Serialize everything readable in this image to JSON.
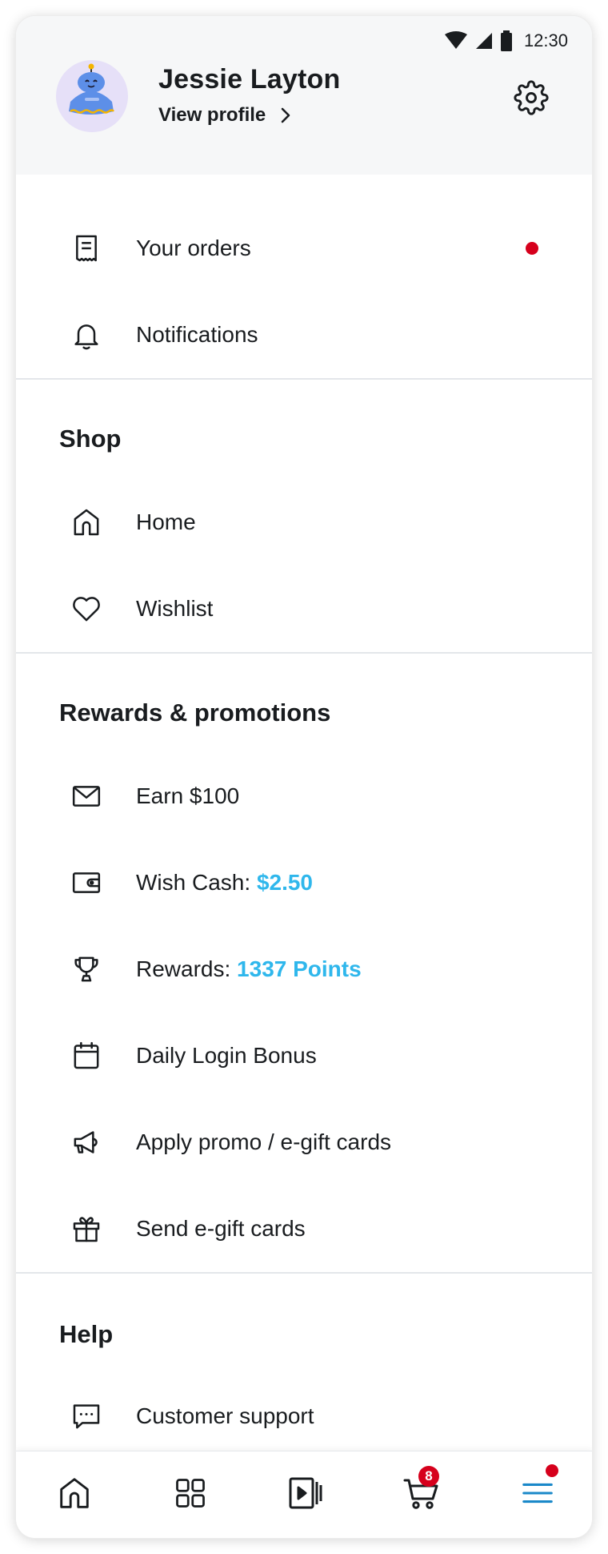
{
  "status_bar": {
    "time": "12:30"
  },
  "profile": {
    "name": "Jessie Layton",
    "view_profile_label": "View profile"
  },
  "account_items": [
    {
      "label": "Your orders",
      "icon": "receipt-icon",
      "has_alert_dot": true
    },
    {
      "label": "Notifications",
      "icon": "bell-icon"
    }
  ],
  "sections": {
    "shop": {
      "title": "Shop",
      "items": [
        {
          "label": "Home",
          "icon": "home-icon"
        },
        {
          "label": "Wishlist",
          "icon": "heart-icon"
        }
      ]
    },
    "rewards": {
      "title": "Rewards & promotions",
      "items": [
        {
          "label": "Earn $100",
          "icon": "mail-icon"
        },
        {
          "label": "Wish Cash: ",
          "value": "$2.50",
          "icon": "wallet-icon"
        },
        {
          "label": "Rewards: ",
          "value": "1337 Points",
          "icon": "trophy-icon"
        },
        {
          "label": "Daily Login Bonus",
          "icon": "calendar-icon"
        },
        {
          "label": "Apply promo / e-gift cards",
          "icon": "megaphone-icon"
        },
        {
          "label": "Send e-gift cards",
          "icon": "gift-icon"
        }
      ]
    },
    "help": {
      "title": "Help",
      "items": [
        {
          "label": "Customer support",
          "icon": "chat-icon"
        }
      ]
    }
  },
  "bottom_nav": {
    "items": [
      "home-icon",
      "categories-icon",
      "video-icon",
      "cart-icon",
      "menu-icon"
    ],
    "cart_count": "8",
    "active": "menu-icon"
  },
  "colors": {
    "accent": "#2fb7ec",
    "alert": "#d6001c",
    "active_nav": "#1a88c9",
    "header_bg": "#f6f7f8",
    "text": "#191c1f"
  }
}
